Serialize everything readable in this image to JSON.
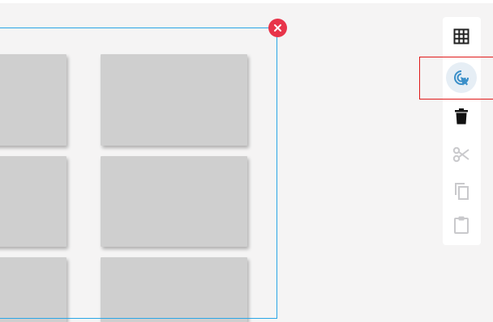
{
  "toolbar": {
    "items": [
      {
        "icon": "grid-icon",
        "state": "enabled"
      },
      {
        "icon": "select-pointer-icon",
        "state": "active"
      },
      {
        "icon": "trash-icon",
        "state": "enabled"
      },
      {
        "icon": "scissors-icon",
        "state": "disabled"
      },
      {
        "icon": "copy-icon",
        "state": "disabled"
      },
      {
        "icon": "clipboard-icon",
        "state": "disabled"
      }
    ]
  },
  "selection": {
    "close_icon": "close-icon"
  },
  "colors": {
    "selection_border": "#2aa6e6",
    "close_button": "#e8344a",
    "active_tool": "#3a8fc9",
    "highlight_box": "#e01a1a",
    "tile": "#cfcfcf"
  }
}
